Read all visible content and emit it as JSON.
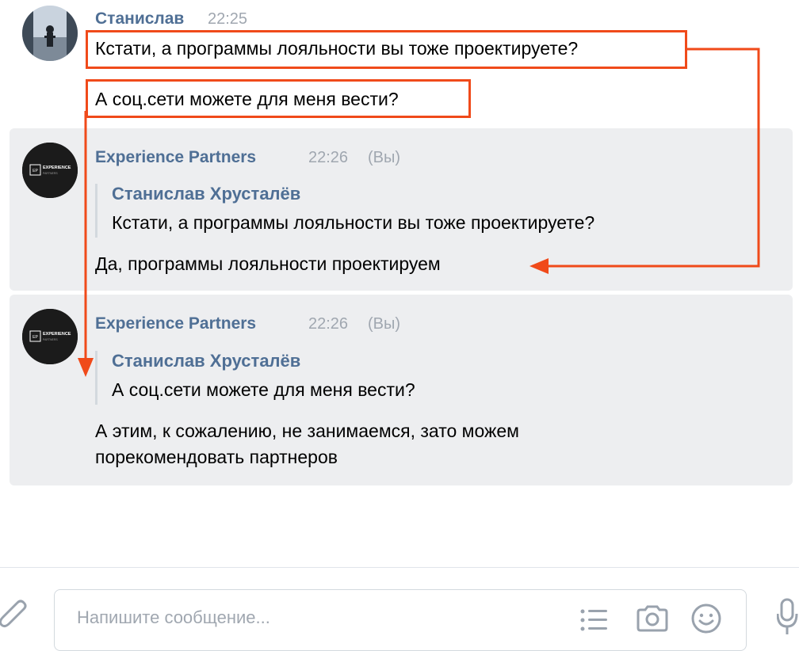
{
  "messages": [
    {
      "author": "Станислав",
      "time": "22:25",
      "lines": [
        "Кстати, а программы лояльности вы тоже проектируете?",
        "А соц.сети можете для меня вести?"
      ]
    },
    {
      "author": "Experience Partners",
      "time": "22:26",
      "you_label": "(Вы)",
      "reply_to": {
        "author": "Станислав Хрусталёв",
        "text": "Кстати, а программы лояльности вы тоже проектируете?"
      },
      "text": "Да, программы лояльности проектируем"
    },
    {
      "author": "Experience Partners",
      "time": "22:26",
      "you_label": "(Вы)",
      "reply_to": {
        "author": "Станислав Хрусталёв",
        "text": "А соц.сети можете для меня вести?"
      },
      "text_lines": [
        "А этим, к сожалению, не занимаемся, зато можем",
        "порекомендовать партнеров"
      ]
    }
  ],
  "logo": {
    "badge": "EP",
    "name": "EXPERIENCE",
    "sub": "PARTNERS"
  },
  "composer": {
    "placeholder": "Напишите сообщение..."
  },
  "colors": {
    "accent": "#4f6f95",
    "highlight": "#f04a1a",
    "bubble": "#edeef0"
  },
  "icons": [
    "paperclip-icon",
    "list-icon",
    "camera-icon",
    "smile-icon",
    "microphone-icon"
  ]
}
